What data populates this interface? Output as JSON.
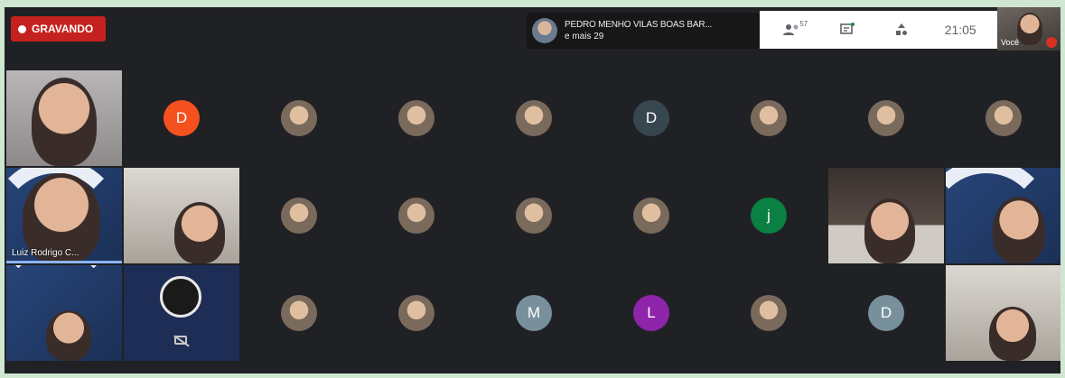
{
  "meeting": {
    "recording_label": "GRAVANDO",
    "presenter_name": "PEDRO MENHO VILAS BOAS BAR...",
    "presenter_more": "e mais 29",
    "participant_count": "57",
    "clock": "21:05",
    "self_label": "Você"
  },
  "colors": {
    "recording": "#c5221f",
    "background": "#202124",
    "speaking": "#8ab4f8"
  },
  "tiles": {
    "r1": [
      {
        "kind": "camera"
      },
      {
        "kind": "letter",
        "letter": "D",
        "color": "#f4511e"
      },
      {
        "kind": "photo"
      },
      {
        "kind": "photo"
      },
      {
        "kind": "photo"
      },
      {
        "kind": "letter",
        "letter": "D",
        "color": "#37474f"
      },
      {
        "kind": "photo"
      },
      {
        "kind": "photo"
      },
      {
        "kind": "photo"
      }
    ],
    "r2": [
      {
        "kind": "camera",
        "label": "Luiz Rodrigo C..."
      },
      {
        "kind": "camera"
      },
      {
        "kind": "photo"
      },
      {
        "kind": "photo"
      },
      {
        "kind": "photo"
      },
      {
        "kind": "photo"
      },
      {
        "kind": "letter",
        "letter": "j",
        "color": "#0b8043"
      },
      {
        "kind": "camera"
      },
      {
        "kind": "camera"
      }
    ],
    "r3": [
      {
        "kind": "camera"
      },
      {
        "kind": "camera"
      },
      {
        "kind": "photo"
      },
      {
        "kind": "photo"
      },
      {
        "kind": "letter",
        "letter": "M",
        "color": "#78909c"
      },
      {
        "kind": "letter",
        "letter": "L",
        "color": "#8e24aa"
      },
      {
        "kind": "photo"
      },
      {
        "kind": "letter",
        "letter": "D",
        "color": "#78909c"
      },
      {
        "kind": "camera"
      }
    ]
  }
}
